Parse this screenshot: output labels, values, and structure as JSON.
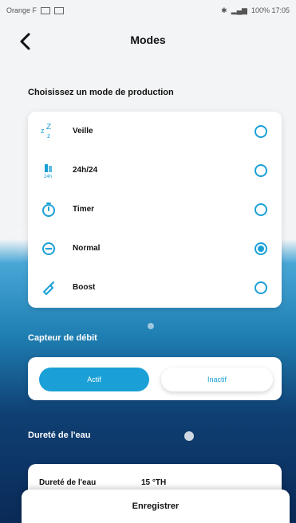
{
  "status_bar": {
    "carrier": "Orange F",
    "right": "100% 17:05"
  },
  "header": {
    "title": "Modes"
  },
  "production": {
    "section_title": "Choisissez un mode de production",
    "modes": [
      {
        "label": "Veille",
        "icon": "sleep-zz-icon",
        "selected": false
      },
      {
        "label": "24h/24",
        "icon": "24h-icon",
        "selected": false
      },
      {
        "label": "Timer",
        "icon": "timer-icon",
        "selected": false
      },
      {
        "label": "Normal",
        "icon": "minus-circle-icon",
        "selected": true
      },
      {
        "label": "Boost",
        "icon": "boost-icon",
        "selected": false
      }
    ]
  },
  "flow_sensor": {
    "section_title": "Capteur de débit",
    "active_label": "Actif",
    "inactive_label": "Inactif",
    "selected": "Actif"
  },
  "water_hardness": {
    "section_title": "Dureté de l'eau",
    "label": "Dureté de l'eau",
    "value": "15 °TH"
  },
  "save": {
    "label": "Enregistrer"
  },
  "colors": {
    "accent": "#1aa0d6"
  }
}
